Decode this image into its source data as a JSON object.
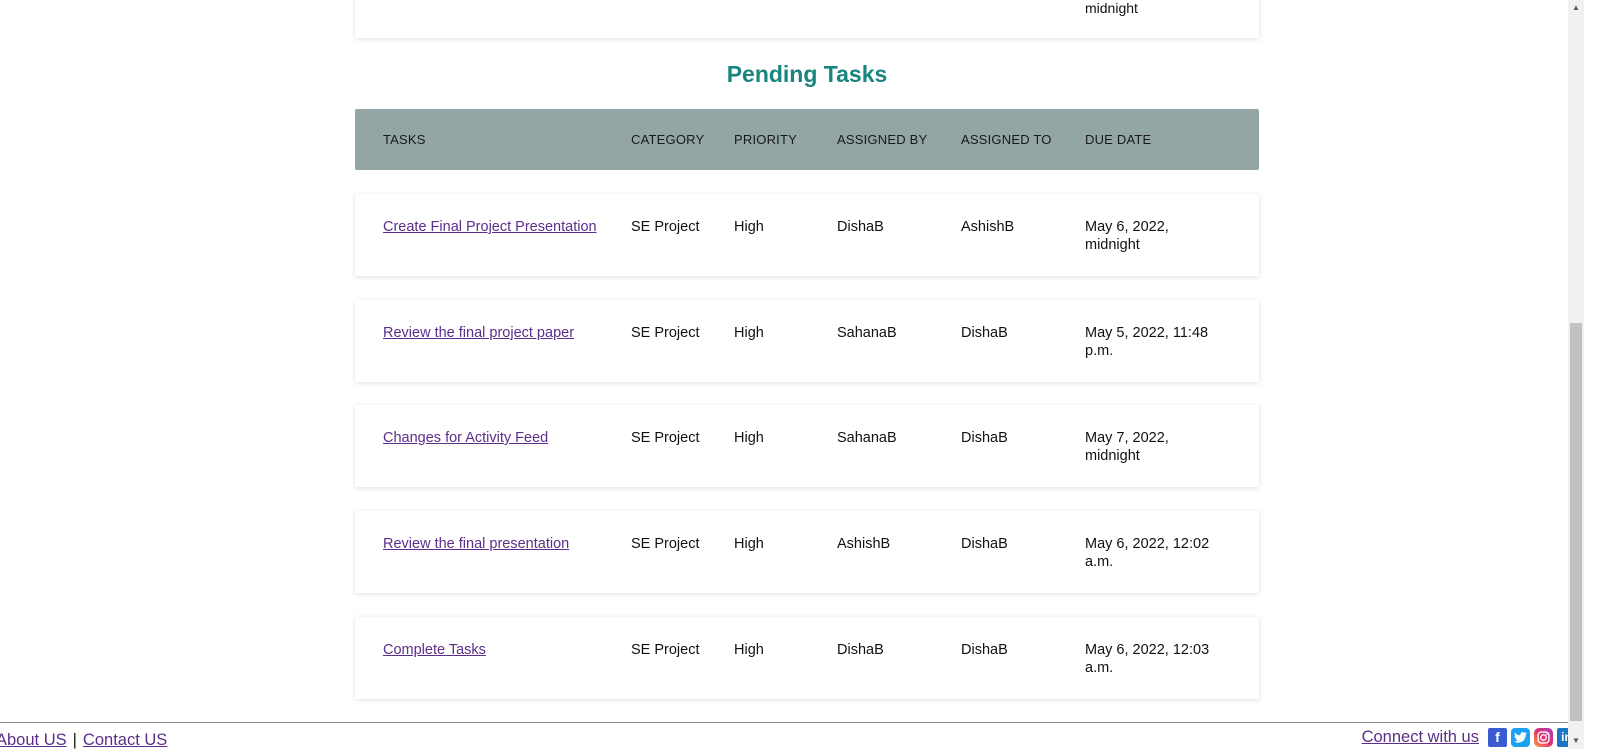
{
  "previous_card": {
    "due_date_fragment": "midnight"
  },
  "section": {
    "title": "Pending Tasks"
  },
  "table": {
    "headers": {
      "tasks": "TASKS",
      "category": "CATEGORY",
      "priority": "PRIORITY",
      "assigned_by": "ASSIGNED BY",
      "assigned_to": "ASSIGNED TO",
      "due_date": "DUE DATE"
    },
    "rows": [
      {
        "task": "Create Final Project Presentation",
        "category": "SE Project",
        "priority": "High",
        "assigned_by": "DishaB",
        "assigned_to": "AshishB",
        "due_date": "May 6, 2022, midnight"
      },
      {
        "task": "Review the final project paper",
        "category": "SE Project",
        "priority": "High",
        "assigned_by": "SahanaB",
        "assigned_to": "DishaB",
        "due_date": "May 5, 2022, 11:48 p.m."
      },
      {
        "task": "Changes for Activity Feed",
        "category": "SE Project",
        "priority": "High",
        "assigned_by": "SahanaB",
        "assigned_to": "DishaB",
        "due_date": "May 7, 2022, midnight"
      },
      {
        "task": "Review the final presentation",
        "category": "SE Project",
        "priority": "High",
        "assigned_by": "AshishB",
        "assigned_to": "DishaB",
        "due_date": "May 6, 2022, 12:02 a.m."
      },
      {
        "task": "Complete Tasks",
        "category": "SE Project",
        "priority": "High",
        "assigned_by": "DishaB",
        "assigned_to": "DishaB",
        "due_date": "May 6, 2022, 12:03 a.m."
      }
    ]
  },
  "footer": {
    "about": "About US",
    "separator": "|",
    "contact": "Contact US",
    "connect": "Connect with us",
    "social_icons": [
      "facebook-icon",
      "twitter-icon",
      "instagram-icon",
      "linkedin-icon"
    ]
  },
  "colors": {
    "title": "#19857f",
    "header_bg": "#93a5a4",
    "link": "#5c2e8a"
  }
}
